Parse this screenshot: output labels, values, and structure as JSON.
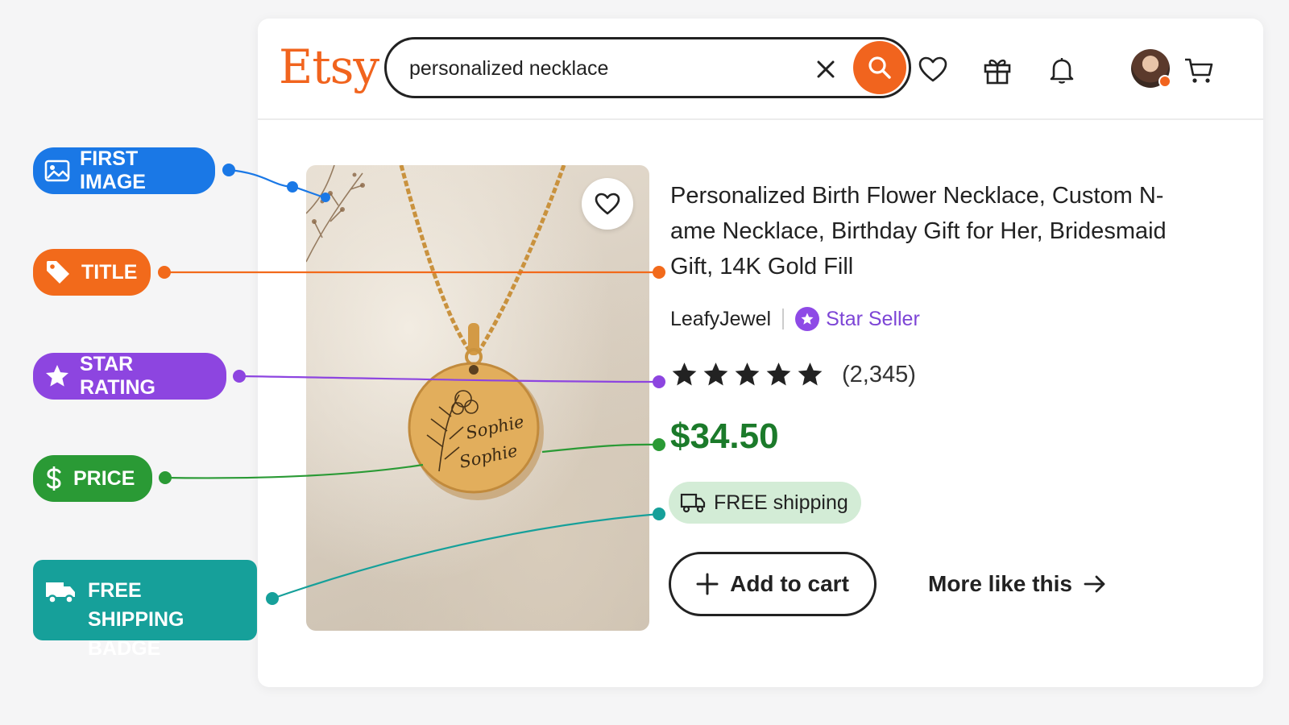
{
  "header": {
    "logo": "Etsy",
    "search": {
      "value": "personalized necklace"
    },
    "icons": [
      "heart-icon",
      "gift-icon",
      "bell-icon",
      "avatar",
      "cart-icon"
    ]
  },
  "listing": {
    "title": "Personalized Birth Flower Necklace, Custom N-ame Necklace, Birthday Gift for Her, Bridesmaid Gift, 14K Gold Fill",
    "seller": "LeafyJewel",
    "seller_badge": "Star Seller",
    "rating": 5,
    "reviews": "(2,345)",
    "price": "$34.50",
    "shipping_badge": "FREE shipping",
    "add_to_cart": "Add to cart",
    "more_like_this": "More like this",
    "engraving": [
      "Sophie",
      "Sophie"
    ]
  },
  "callouts": {
    "first_image": "FIRST IMAGE",
    "title": "TITLE",
    "star_rating": "STAR RATING",
    "price": "PRICE",
    "free_shipping_line1": "FREE SHIPPING",
    "free_shipping_line2": "BADGE"
  },
  "colors": {
    "etsy_orange": "#f1641e",
    "first_image": "#1a78e6",
    "title": "#f26a1b",
    "star_rating": "#8d45e0",
    "price": "#2a9a35",
    "free_shipping": "#16a09a",
    "price_text": "#1b7a2a",
    "star_seller": "#7d45d6"
  }
}
